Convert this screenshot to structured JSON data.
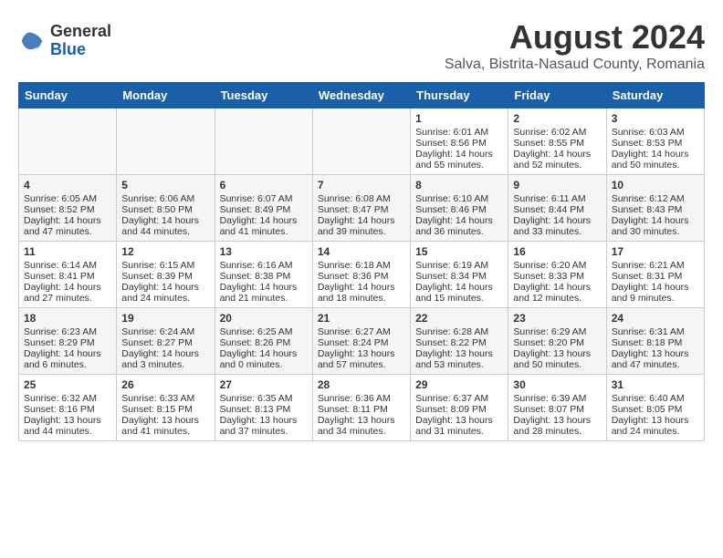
{
  "header": {
    "logo": {
      "general": "General",
      "blue": "Blue"
    },
    "title": "August 2024",
    "location": "Salva, Bistrita-Nasaud County, Romania"
  },
  "calendar": {
    "weekdays": [
      "Sunday",
      "Monday",
      "Tuesday",
      "Wednesday",
      "Thursday",
      "Friday",
      "Saturday"
    ],
    "weeks": [
      [
        {
          "day": "",
          "content": ""
        },
        {
          "day": "",
          "content": ""
        },
        {
          "day": "",
          "content": ""
        },
        {
          "day": "",
          "content": ""
        },
        {
          "day": "1",
          "content": "Sunrise: 6:01 AM\nSunset: 8:56 PM\nDaylight: 14 hours\nand 55 minutes."
        },
        {
          "day": "2",
          "content": "Sunrise: 6:02 AM\nSunset: 8:55 PM\nDaylight: 14 hours\nand 52 minutes."
        },
        {
          "day": "3",
          "content": "Sunrise: 6:03 AM\nSunset: 8:53 PM\nDaylight: 14 hours\nand 50 minutes."
        }
      ],
      [
        {
          "day": "4",
          "content": "Sunrise: 6:05 AM\nSunset: 8:52 PM\nDaylight: 14 hours\nand 47 minutes."
        },
        {
          "day": "5",
          "content": "Sunrise: 6:06 AM\nSunset: 8:50 PM\nDaylight: 14 hours\nand 44 minutes."
        },
        {
          "day": "6",
          "content": "Sunrise: 6:07 AM\nSunset: 8:49 PM\nDaylight: 14 hours\nand 41 minutes."
        },
        {
          "day": "7",
          "content": "Sunrise: 6:08 AM\nSunset: 8:47 PM\nDaylight: 14 hours\nand 39 minutes."
        },
        {
          "day": "8",
          "content": "Sunrise: 6:10 AM\nSunset: 8:46 PM\nDaylight: 14 hours\nand 36 minutes."
        },
        {
          "day": "9",
          "content": "Sunrise: 6:11 AM\nSunset: 8:44 PM\nDaylight: 14 hours\nand 33 minutes."
        },
        {
          "day": "10",
          "content": "Sunrise: 6:12 AM\nSunset: 8:43 PM\nDaylight: 14 hours\nand 30 minutes."
        }
      ],
      [
        {
          "day": "11",
          "content": "Sunrise: 6:14 AM\nSunset: 8:41 PM\nDaylight: 14 hours\nand 27 minutes."
        },
        {
          "day": "12",
          "content": "Sunrise: 6:15 AM\nSunset: 8:39 PM\nDaylight: 14 hours\nand 24 minutes."
        },
        {
          "day": "13",
          "content": "Sunrise: 6:16 AM\nSunset: 8:38 PM\nDaylight: 14 hours\nand 21 minutes."
        },
        {
          "day": "14",
          "content": "Sunrise: 6:18 AM\nSunset: 8:36 PM\nDaylight: 14 hours\nand 18 minutes."
        },
        {
          "day": "15",
          "content": "Sunrise: 6:19 AM\nSunset: 8:34 PM\nDaylight: 14 hours\nand 15 minutes."
        },
        {
          "day": "16",
          "content": "Sunrise: 6:20 AM\nSunset: 8:33 PM\nDaylight: 14 hours\nand 12 minutes."
        },
        {
          "day": "17",
          "content": "Sunrise: 6:21 AM\nSunset: 8:31 PM\nDaylight: 14 hours\nand 9 minutes."
        }
      ],
      [
        {
          "day": "18",
          "content": "Sunrise: 6:23 AM\nSunset: 8:29 PM\nDaylight: 14 hours\nand 6 minutes."
        },
        {
          "day": "19",
          "content": "Sunrise: 6:24 AM\nSunset: 8:27 PM\nDaylight: 14 hours\nand 3 minutes."
        },
        {
          "day": "20",
          "content": "Sunrise: 6:25 AM\nSunset: 8:26 PM\nDaylight: 14 hours\nand 0 minutes."
        },
        {
          "day": "21",
          "content": "Sunrise: 6:27 AM\nSunset: 8:24 PM\nDaylight: 13 hours\nand 57 minutes."
        },
        {
          "day": "22",
          "content": "Sunrise: 6:28 AM\nSunset: 8:22 PM\nDaylight: 13 hours\nand 53 minutes."
        },
        {
          "day": "23",
          "content": "Sunrise: 6:29 AM\nSunset: 8:20 PM\nDaylight: 13 hours\nand 50 minutes."
        },
        {
          "day": "24",
          "content": "Sunrise: 6:31 AM\nSunset: 8:18 PM\nDaylight: 13 hours\nand 47 minutes."
        }
      ],
      [
        {
          "day": "25",
          "content": "Sunrise: 6:32 AM\nSunset: 8:16 PM\nDaylight: 13 hours\nand 44 minutes."
        },
        {
          "day": "26",
          "content": "Sunrise: 6:33 AM\nSunset: 8:15 PM\nDaylight: 13 hours\nand 41 minutes."
        },
        {
          "day": "27",
          "content": "Sunrise: 6:35 AM\nSunset: 8:13 PM\nDaylight: 13 hours\nand 37 minutes."
        },
        {
          "day": "28",
          "content": "Sunrise: 6:36 AM\nSunset: 8:11 PM\nDaylight: 13 hours\nand 34 minutes."
        },
        {
          "day": "29",
          "content": "Sunrise: 6:37 AM\nSunset: 8:09 PM\nDaylight: 13 hours\nand 31 minutes."
        },
        {
          "day": "30",
          "content": "Sunrise: 6:39 AM\nSunset: 8:07 PM\nDaylight: 13 hours\nand 28 minutes."
        },
        {
          "day": "31",
          "content": "Sunrise: 6:40 AM\nSunset: 8:05 PM\nDaylight: 13 hours\nand 24 minutes."
        }
      ]
    ]
  }
}
